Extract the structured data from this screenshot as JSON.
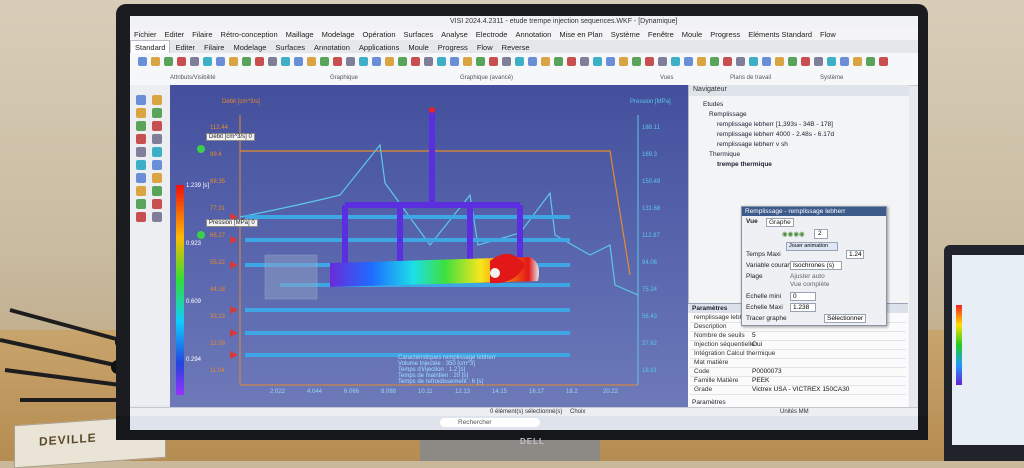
{
  "titlebar": {
    "text": "VISI 2024.4.2311 - etude trempe injection sequences.WKF - [Dynamique]"
  },
  "menu": {
    "items": [
      "Fichier",
      "Editer",
      "Filaire",
      "Rétro-conception",
      "Maillage",
      "Modelage",
      "Opération",
      "Surfaces",
      "Analyse",
      "Electrode",
      "Annotation",
      "Mise en Plan",
      "Système",
      "Fenêtre",
      "Moule",
      "Progress",
      "Eléments Standard",
      "Flow"
    ]
  },
  "tabs": {
    "items": [
      "Standard",
      "Editer",
      "Filaire",
      "Modelage",
      "Surfaces",
      "Annotation",
      "Applications",
      "Moule",
      "Progress",
      "Flow",
      "Reverse"
    ],
    "active": 0
  },
  "ribbon": {
    "groups": [
      "Attributs/Visibilité",
      "Graphique",
      "Graphique (avancé)",
      "Vues",
      "Plans de travail",
      "Système"
    ]
  },
  "viewport": {
    "axis_left_label": "Débit [cm^3/s]",
    "axis_right_label": "Pression [MPa]",
    "left_ticks": [
      "112.44",
      "99.4",
      "88.35",
      "77.31",
      "66.27",
      "55.22",
      "44.18",
      "33.13",
      "22.09",
      "11.04"
    ],
    "right_ticks": [
      "188.11",
      "169.3",
      "150.49",
      "131.68",
      "112.87",
      "94.06",
      "75.24",
      "56.43",
      "37.62",
      "18.81"
    ],
    "bottom_ticks": [
      "2.022",
      "4.044",
      "6.066",
      "8.088",
      "10.11",
      "12.13",
      "14.15",
      "16.17",
      "18.2",
      "20.22"
    ],
    "scale_labels": [
      "1.239 [s]",
      "0.923",
      "0.609",
      "0.294"
    ],
    "tag_debit": "Débit [cm^3/s] 0",
    "tag_pression": "Pression [MPa] 0",
    "legend_lines": [
      "Caractéristiques remplissage  lebherr",
      "Volume  Injectée   : 350 [cm^3]",
      "Temps d'injection   : 1.2 [s]",
      "Temps de maintien : 20 [s]",
      "Temps de refroidissement : 6 [s]"
    ]
  },
  "navigator": {
    "title": "Navigateur",
    "tree": [
      "Etudes",
      "Remplissage",
      "remplissage lebherr [1,393s - 34B - 178]",
      "remplissage lebherr 4000 - 2.48s - 6.17d",
      "remplissage lebherr v sh",
      "Thermique",
      "trempe thermique"
    ]
  },
  "float_panel": {
    "title": "Remplissage - remplissage lebherr",
    "tabs": [
      "Vue",
      "Graphe"
    ],
    "stepper_value": "2",
    "temps_label": "Temps Maxi",
    "temps_value": "1.24",
    "temps_btn": "Jouer animation",
    "variable_label": "Variable courante",
    "variable_value": "Isochrones (s)",
    "plage_label": "Plage",
    "opt1": "Ajuster auto",
    "opt2": "Vue complète",
    "emin_label": "Echelle mini",
    "emin_value": "0",
    "emax_label": "Echelle Maxi",
    "emax_value": "1.238",
    "tracer_label": "Tracer graphe",
    "tracer_btn": "Sélectionner"
  },
  "params": {
    "header": "Paramètres",
    "rows": [
      {
        "k": "remplissage lebherr",
        "v": ""
      },
      {
        "k": "Description",
        "v": ""
      },
      {
        "k": "Nombre de seuils",
        "v": "5"
      },
      {
        "k": "Injection séquentielle",
        "v": "Oui"
      },
      {
        "k": "Intégration Calcul thermique",
        "v": ""
      },
      {
        "k": "Mat matière",
        "v": ""
      },
      {
        "k": "Code",
        "v": "P0000073"
      },
      {
        "k": "Famille Matière",
        "v": "PEEK"
      },
      {
        "k": "Grade",
        "v": "Victrex USA - VICTREX 150CA30"
      }
    ],
    "footer": "Paramètres"
  },
  "status": {
    "left": "0 élément(s) sélectionné(s)",
    "mid": "Choix",
    "right": "Unités MM"
  },
  "taskbar": {
    "search": "Rechercher"
  },
  "brand": {
    "monitor": "DELL",
    "box": "DEVILLE"
  }
}
